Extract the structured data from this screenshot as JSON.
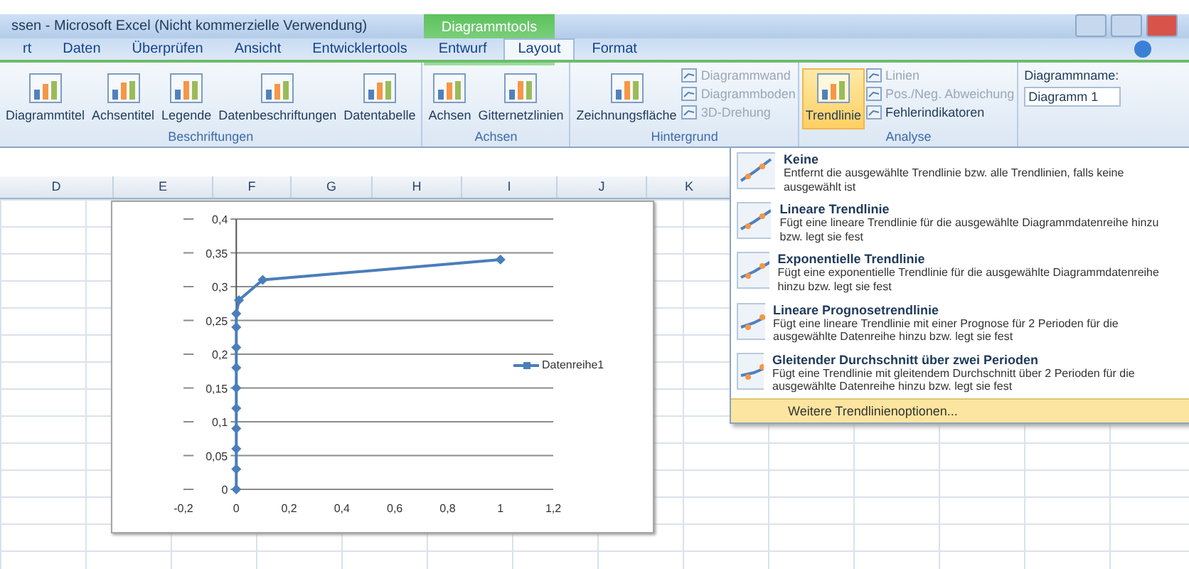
{
  "window": {
    "title": "ssen - Microsoft Excel (Nicht kommerzielle Verwendung)",
    "context_label": "Diagrammtools"
  },
  "tabs": [
    {
      "label": "rt",
      "selected": false
    },
    {
      "label": "Daten",
      "selected": false
    },
    {
      "label": "Überprüfen",
      "selected": false
    },
    {
      "label": "Ansicht",
      "selected": false
    },
    {
      "label": "Entwicklertools",
      "selected": false
    },
    {
      "label": "Entwurf",
      "selected": false
    },
    {
      "label": "Layout",
      "selected": true
    },
    {
      "label": "Format",
      "selected": false
    }
  ],
  "ribbon": {
    "groups": [
      {
        "label": "Beschriftungen",
        "buttons": [
          {
            "label": "Diagrammtitel",
            "disabled": false
          },
          {
            "label": "Achsentitel",
            "disabled": false
          },
          {
            "label": "Legende",
            "disabled": false
          },
          {
            "label": "Datenbeschriftungen",
            "disabled": false
          },
          {
            "label": "Datentabelle",
            "disabled": false
          }
        ]
      },
      {
        "label": "Achsen",
        "buttons": [
          {
            "label": "Achsen",
            "disabled": false
          },
          {
            "label": "Gitternetzlinien",
            "disabled": false
          }
        ]
      },
      {
        "label": "Hintergrund",
        "buttons": [
          {
            "label": "Zeichnungsfläche",
            "disabled": false
          }
        ],
        "small_buttons": [
          {
            "label": "Diagrammwand",
            "disabled": true
          },
          {
            "label": "Diagrammboden",
            "disabled": true
          },
          {
            "label": "3D-Drehung",
            "disabled": true
          }
        ]
      },
      {
        "label": "Analyse",
        "buttons": [
          {
            "label": "Trendlinie",
            "disabled": false,
            "selected": true
          }
        ],
        "small_buttons": [
          {
            "label": "Linien",
            "disabled": true
          },
          {
            "label": "Pos./Neg. Abweichung",
            "disabled": true
          },
          {
            "label": "Fehlerindikatoren",
            "disabled": false
          }
        ]
      }
    ],
    "name_box": {
      "label": "Diagrammname:",
      "value": "Diagramm 1"
    }
  },
  "columns": [
    "D",
    "E",
    "F",
    "G",
    "H",
    "I",
    "J",
    "K"
  ],
  "chart": {
    "chart_data": {
      "type": "line",
      "grid": true,
      "x": [
        0,
        0,
        0,
        0,
        0,
        0,
        0,
        0,
        0,
        0,
        0.01,
        0.1,
        1
      ],
      "series": [
        {
          "name": "Datenreihe1",
          "color": "#4a7ebb",
          "marker": "diamond",
          "values": [
            0,
            0.03,
            0.06,
            0.09,
            0.12,
            0.15,
            0.18,
            0.21,
            0.24,
            0.26,
            0.28,
            0.31,
            0.34
          ]
        }
      ],
      "xlim": [
        -0.2,
        1.2
      ],
      "ylim": [
        0,
        0.4
      ],
      "xticks": [
        {
          "value": -0.2,
          "label": "-0,2"
        },
        {
          "value": 0,
          "label": "0"
        },
        {
          "value": 0.2,
          "label": "0,2"
        },
        {
          "value": 0.4,
          "label": "0,4"
        },
        {
          "value": 0.6,
          "label": "0,6"
        },
        {
          "value": 0.8,
          "label": "0,8"
        },
        {
          "value": 1,
          "label": "1"
        },
        {
          "value": 1.2,
          "label": "1,2"
        }
      ],
      "yticks": [
        {
          "value": 0,
          "label": "0"
        },
        {
          "value": 0.05,
          "label": "0,05"
        },
        {
          "value": 0.1,
          "label": "0,1"
        },
        {
          "value": 0.15,
          "label": "0,15"
        },
        {
          "value": 0.2,
          "label": "0,2"
        },
        {
          "value": 0.25,
          "label": "0,25"
        },
        {
          "value": 0.3,
          "label": "0,3"
        },
        {
          "value": 0.35,
          "label": "0,35"
        },
        {
          "value": 0.4,
          "label": "0,4"
        }
      ]
    }
  },
  "trendline_menu": {
    "items": [
      {
        "title": "Keine",
        "description": "Entfernt die ausgewählte Trendlinie bzw. alle Trendlinien, falls keine ausgewählt ist",
        "selected": false
      },
      {
        "title": "Lineare Trendlinie",
        "description": "Fügt eine lineare Trendlinie für die ausgewählte Diagrammdatenreihe hinzu bzw. legt sie fest",
        "selected": false
      },
      {
        "title": "Exponentielle Trendlinie",
        "description": "Fügt eine exponentielle Trendlinie für die ausgewählte Diagrammdatenreihe hinzu bzw. legt sie fest",
        "selected": false
      },
      {
        "title": "Lineare Prognosetrendlinie",
        "description": "Fügt eine lineare Trendlinie mit einer Prognose für 2 Perioden für die ausgewählte Datenreihe hinzu bzw. legt sie fest",
        "selected": false
      },
      {
        "title": "Gleitender Durchschnitt über zwei Perioden",
        "description": "Fügt eine Trendlinie mit gleitendem Durchschnitt über 2 Perioden für die ausgewählte Datenreihe hinzu bzw. legt sie fest",
        "selected": false
      }
    ],
    "footer": {
      "label": "Weitere Trendlinienoptionen...",
      "selected": true
    }
  }
}
